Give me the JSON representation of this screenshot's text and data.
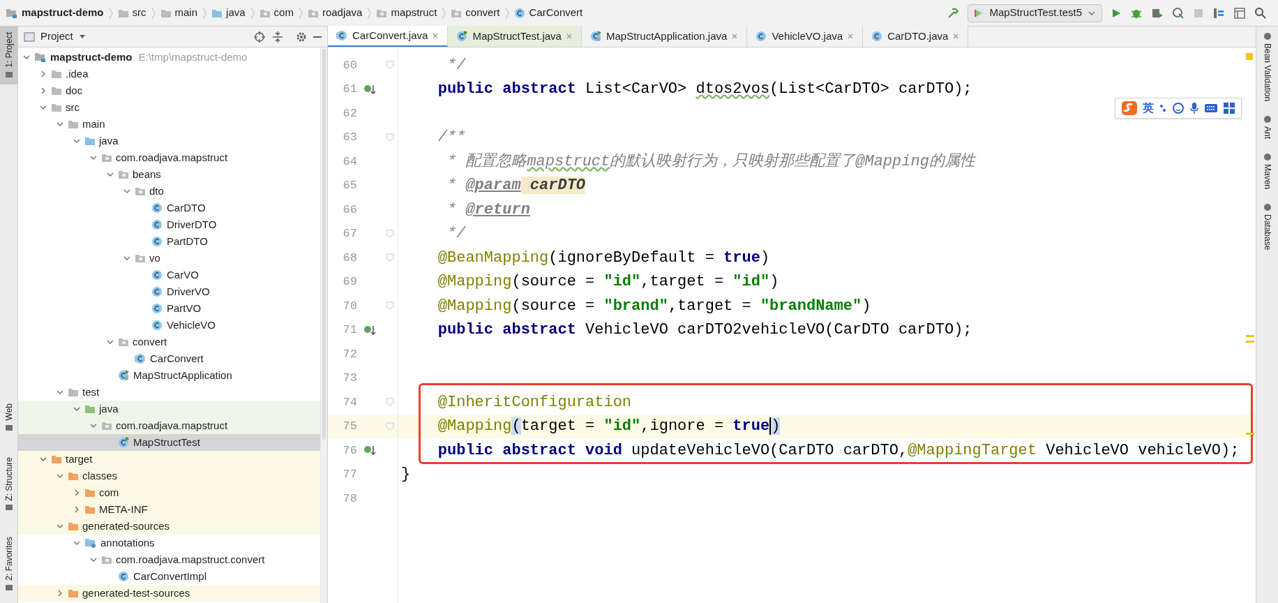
{
  "breadcrumbs": [
    {
      "label": "mapstruct-demo",
      "kind": "project"
    },
    {
      "label": "src",
      "kind": "folder"
    },
    {
      "label": "main",
      "kind": "folder"
    },
    {
      "label": "java",
      "kind": "source-root"
    },
    {
      "label": "com",
      "kind": "package"
    },
    {
      "label": "roadjava",
      "kind": "package"
    },
    {
      "label": "mapstruct",
      "kind": "package"
    },
    {
      "label": "convert",
      "kind": "package"
    },
    {
      "label": "CarConvert",
      "kind": "class"
    }
  ],
  "toolbar": {
    "run_config": "MapStructTest.test5"
  },
  "left_tool_windows": {
    "top": [
      {
        "label": "1: Project",
        "selected": true
      }
    ],
    "bottom": [
      {
        "label": "Web",
        "selected": false
      },
      {
        "label": "Z: Structure",
        "selected": false
      },
      {
        "label": "2: Favorites",
        "selected": false
      }
    ]
  },
  "right_tool_windows": [
    "Bean Validation",
    "Ant",
    "Maven",
    "Database"
  ],
  "project_panel": {
    "title": "Project",
    "tree": [
      {
        "label": "mapstruct-demo",
        "path": "E:\\tmp\\mapstruct-demo",
        "kind": "project",
        "expanded": true,
        "selected": false,
        "children": [
          {
            "label": ".idea",
            "kind": "folder",
            "expanded": false,
            "selected": false
          },
          {
            "label": "doc",
            "kind": "folder",
            "expanded": false,
            "selected": false
          },
          {
            "label": "src",
            "kind": "folder",
            "expanded": true,
            "selected": false,
            "children": [
              {
                "label": "main",
                "kind": "folder",
                "expanded": true,
                "selected": false,
                "children": [
                  {
                    "label": "java",
                    "kind": "source-root",
                    "expanded": true,
                    "selected": false,
                    "children": [
                      {
                        "label": "com.roadjava.mapstruct",
                        "kind": "package",
                        "expanded": true,
                        "selected": false,
                        "children": [
                          {
                            "label": "beans",
                            "kind": "package",
                            "expanded": true,
                            "selected": false,
                            "children": [
                              {
                                "label": "dto",
                                "kind": "package",
                                "expanded": true,
                                "selected": false,
                                "children": [
                                  {
                                    "label": "CarDTO",
                                    "kind": "class",
                                    "selected": false
                                  },
                                  {
                                    "label": "DriverDTO",
                                    "kind": "class",
                                    "selected": false
                                  },
                                  {
                                    "label": "PartDTO",
                                    "kind": "class",
                                    "selected": false
                                  }
                                ]
                              },
                              {
                                "label": "vo",
                                "kind": "package",
                                "expanded": true,
                                "selected": false,
                                "children": [
                                  {
                                    "label": "CarVO",
                                    "kind": "class",
                                    "selected": false
                                  },
                                  {
                                    "label": "DriverVO",
                                    "kind": "class",
                                    "selected": false
                                  },
                                  {
                                    "label": "PartVO",
                                    "kind": "class",
                                    "selected": false
                                  },
                                  {
                                    "label": "VehicleVO",
                                    "kind": "class",
                                    "selected": false
                                  }
                                ]
                              }
                            ]
                          },
                          {
                            "label": "convert",
                            "kind": "package",
                            "expanded": true,
                            "selected": false,
                            "children": [
                              {
                                "label": "CarConvert",
                                "kind": "interface",
                                "selected": false
                              }
                            ]
                          },
                          {
                            "label": "MapStructApplication",
                            "kind": "app-class",
                            "selected": false
                          }
                        ]
                      }
                    ]
                  }
                ]
              },
              {
                "label": "test",
                "kind": "folder",
                "expanded": true,
                "selected": false,
                "children": [
                  {
                    "label": "java",
                    "kind": "test-root",
                    "expanded": true,
                    "selected": false,
                    "children": [
                      {
                        "label": "com.roadjava.mapstruct",
                        "kind": "package",
                        "expanded": true,
                        "selected": false,
                        "children": [
                          {
                            "label": "MapStructTest",
                            "kind": "test-class",
                            "selected": true
                          }
                        ]
                      }
                    ]
                  }
                ]
              }
            ]
          },
          {
            "label": "target",
            "kind": "excluded",
            "expanded": true,
            "selected": false,
            "children": [
              {
                "label": "classes",
                "kind": "folder",
                "expanded": true,
                "selected": false,
                "children": [
                  {
                    "label": "com",
                    "kind": "folder",
                    "expanded": false,
                    "selected": false
                  },
                  {
                    "label": "META-INF",
                    "kind": "folder",
                    "expanded": false,
                    "selected": false
                  }
                ]
              },
              {
                "label": "generated-sources",
                "kind": "folder",
                "expanded": true,
                "selected": false,
                "children": [
                  {
                    "label": "annotations",
                    "kind": "generated-root",
                    "expanded": true,
                    "selected": false,
                    "children": [
                      {
                        "label": "com.roadjava.mapstruct.convert",
                        "kind": "package",
                        "expanded": true,
                        "selected": false,
                        "children": [
                          {
                            "label": "CarConvertImpl",
                            "kind": "class",
                            "selected": false
                          }
                        ]
                      }
                    ]
                  }
                ]
              },
              {
                "label": "generated-test-sources",
                "kind": "folder",
                "expanded": false,
                "selected": false
              }
            ]
          }
        ]
      }
    ]
  },
  "editor_tabs": [
    {
      "label": "CarConvert.java",
      "kind": "interface",
      "selected": true
    },
    {
      "label": "MapStructTest.java",
      "kind": "test-class",
      "selected": false
    },
    {
      "label": "MapStructApplication.java",
      "kind": "app-class",
      "selected": false
    },
    {
      "label": "VehicleVO.java",
      "kind": "class",
      "selected": false
    },
    {
      "label": "CarDTO.java",
      "kind": "class",
      "selected": false
    }
  ],
  "ime_toolbar": {
    "label": "英"
  },
  "code_blocks": [
    {
      "framed": false,
      "lines": [
        {
          "number": "60",
          "foldable": true,
          "implemented": false,
          "current": false,
          "tokens": [
            {
              "kind": "comment",
              "text": "     */"
            }
          ]
        },
        {
          "number": "61",
          "foldable": false,
          "implemented": true,
          "current": false,
          "tokens": [
            {
              "kind": "kw",
              "text": "    public abstract "
            },
            {
              "kind": "plain",
              "text": "List<CarVO> "
            },
            {
              "kind": "typo",
              "text": "dtos2vos"
            },
            {
              "kind": "plain",
              "text": "(List<CarDTO> carDTO);"
            }
          ]
        },
        {
          "number": "62",
          "foldable": false,
          "implemented": false,
          "current": false
        },
        {
          "number": "63",
          "foldable": true,
          "implemented": false,
          "current": false,
          "tokens": [
            {
              "kind": "comment",
              "text": "    /**"
            }
          ]
        },
        {
          "number": "64",
          "foldable": false,
          "implemented": false,
          "current": false,
          "tokens": [
            {
              "kind": "comment",
              "text": "     * 配置忽略"
            },
            {
              "kind": "comment-typo",
              "text": "mapstruct"
            },
            {
              "kind": "comment",
              "text": "的默认映射行为，只映射那些配置了@Mapping的属性"
            }
          ]
        },
        {
          "number": "65",
          "foldable": false,
          "implemented": false,
          "current": false,
          "tokens": [
            {
              "kind": "comment",
              "text": "     * "
            },
            {
              "kind": "doctag",
              "text": "@param"
            },
            {
              "kind": "docref",
              "text": " carDTO"
            }
          ]
        },
        {
          "number": "66",
          "foldable": false,
          "implemented": false,
          "current": false,
          "tokens": [
            {
              "kind": "comment",
              "text": "     * "
            },
            {
              "kind": "doctag",
              "text": "@return"
            }
          ]
        },
        {
          "number": "67",
          "foldable": true,
          "implemented": false,
          "current": false,
          "tokens": [
            {
              "kind": "comment",
              "text": "     */"
            }
          ]
        },
        {
          "number": "68",
          "foldable": true,
          "implemented": false,
          "current": false,
          "tokens": [
            {
              "kind": "anno",
              "text": "    @BeanMapping"
            },
            {
              "kind": "plain",
              "text": "(ignoreByDefault = "
            },
            {
              "kind": "kw",
              "text": "true"
            },
            {
              "kind": "plain",
              "text": ")"
            }
          ]
        },
        {
          "number": "69",
          "foldable": false,
          "implemented": false,
          "current": false,
          "tokens": [
            {
              "kind": "anno",
              "text": "    @Mapping"
            },
            {
              "kind": "plain",
              "text": "(source = "
            },
            {
              "kind": "str",
              "text": "\"id\""
            },
            {
              "kind": "plain",
              "text": ",target = "
            },
            {
              "kind": "str",
              "text": "\"id\""
            },
            {
              "kind": "plain",
              "text": ")"
            }
          ]
        },
        {
          "number": "70",
          "foldable": true,
          "implemented": false,
          "current": false,
          "tokens": [
            {
              "kind": "anno",
              "text": "    @Mapping"
            },
            {
              "kind": "plain",
              "text": "(source = "
            },
            {
              "kind": "str",
              "text": "\"brand\""
            },
            {
              "kind": "plain",
              "text": ",target = "
            },
            {
              "kind": "str",
              "text": "\"brandName\""
            },
            {
              "kind": "plain",
              "text": ")"
            }
          ]
        },
        {
          "number": "71",
          "foldable": false,
          "implemented": true,
          "current": false,
          "tokens": [
            {
              "kind": "kw",
              "text": "    public abstract "
            },
            {
              "kind": "plain",
              "text": "VehicleVO carDTO2vehicleVO(CarDTO carDTO);"
            }
          ]
        },
        {
          "number": "72",
          "foldable": false,
          "implemented": false,
          "current": false
        },
        {
          "number": "73",
          "foldable": false,
          "implemented": false,
          "current": false
        }
      ]
    },
    {
      "framed": true,
      "lines": [
        {
          "number": "74",
          "foldable": true,
          "implemented": false,
          "current": false,
          "tokens": [
            {
              "kind": "anno",
              "text": "    @InheritConfiguration"
            }
          ]
        },
        {
          "number": "75",
          "foldable": true,
          "implemented": false,
          "current": true,
          "tokens": [
            {
              "kind": "anno",
              "text": "    @Mapping"
            },
            {
              "kind": "match",
              "text": "("
            },
            {
              "kind": "plain",
              "text": "target = "
            },
            {
              "kind": "str",
              "text": "\"id\""
            },
            {
              "kind": "plain",
              "text": ",ignore = "
            },
            {
              "kind": "kw-caret",
              "text": "true"
            },
            {
              "kind": "match",
              "text": ")"
            }
          ]
        },
        {
          "number": "76",
          "foldable": false,
          "implemented": true,
          "current": false,
          "tokens": [
            {
              "kind": "kw",
              "text": "    public abstract void "
            },
            {
              "kind": "plain",
              "text": "updateVehicleVO(CarDTO carDTO,"
            },
            {
              "kind": "anno",
              "text": "@MappingTarget"
            },
            {
              "kind": "plain",
              "text": " VehicleVO vehicleVO);"
            }
          ]
        }
      ]
    },
    {
      "framed": false,
      "lines": [
        {
          "number": "77",
          "foldable": false,
          "implemented": false,
          "current": false,
          "tokens": [
            {
              "kind": "plain",
              "text": "}"
            }
          ]
        },
        {
          "number": "78",
          "foldable": false,
          "implemented": false,
          "current": false
        }
      ]
    }
  ]
}
